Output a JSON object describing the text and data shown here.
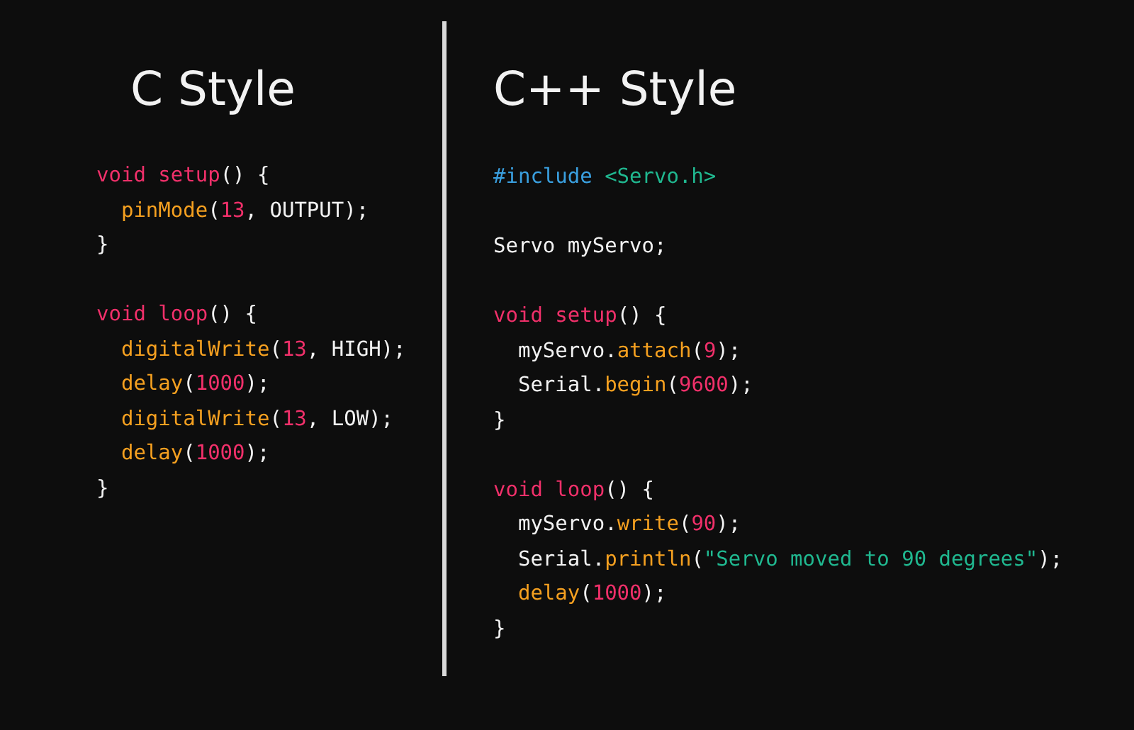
{
  "panels": [
    {
      "title": "C Style",
      "blocks": [
        {
          "lines": [
            {
              "tokens": [
                {
                  "kind": "keyword",
                  "text": "void "
                },
                {
                  "kind": "keyword",
                  "text": "setup"
                },
                {
                  "kind": "plain",
                  "text": "() {"
                }
              ]
            },
            {
              "tokens": [
                {
                  "kind": "function",
                  "text": "  pinMode"
                },
                {
                  "kind": "plain",
                  "text": "("
                },
                {
                  "kind": "number",
                  "text": "13"
                },
                {
                  "kind": "plain",
                  "text": ", OUTPUT);"
                }
              ]
            },
            {
              "tokens": [
                {
                  "kind": "plain",
                  "text": "}"
                }
              ]
            }
          ]
        },
        {
          "lines": [
            {
              "tokens": [
                {
                  "kind": "keyword",
                  "text": "void "
                },
                {
                  "kind": "keyword",
                  "text": "loop"
                },
                {
                  "kind": "plain",
                  "text": "() {"
                }
              ]
            },
            {
              "tokens": [
                {
                  "kind": "function",
                  "text": "  digitalWrite"
                },
                {
                  "kind": "plain",
                  "text": "("
                },
                {
                  "kind": "number",
                  "text": "13"
                },
                {
                  "kind": "plain",
                  "text": ", HIGH);"
                }
              ]
            },
            {
              "tokens": [
                {
                  "kind": "function",
                  "text": "  delay"
                },
                {
                  "kind": "plain",
                  "text": "("
                },
                {
                  "kind": "number",
                  "text": "1000"
                },
                {
                  "kind": "plain",
                  "text": ");"
                }
              ]
            },
            {
              "tokens": [
                {
                  "kind": "function",
                  "text": "  digitalWrite"
                },
                {
                  "kind": "plain",
                  "text": "("
                },
                {
                  "kind": "number",
                  "text": "13"
                },
                {
                  "kind": "plain",
                  "text": ", LOW);"
                }
              ]
            },
            {
              "tokens": [
                {
                  "kind": "function",
                  "text": "  delay"
                },
                {
                  "kind": "plain",
                  "text": "("
                },
                {
                  "kind": "number",
                  "text": "1000"
                },
                {
                  "kind": "plain",
                  "text": ");"
                }
              ]
            },
            {
              "tokens": [
                {
                  "kind": "plain",
                  "text": "}"
                }
              ]
            }
          ]
        }
      ]
    },
    {
      "title": "C++ Style",
      "blocks": [
        {
          "lines": [
            {
              "tokens": [
                {
                  "kind": "preprocessor",
                  "text": "#include "
                },
                {
                  "kind": "string",
                  "text": "<Servo.h>"
                }
              ]
            }
          ]
        },
        {
          "lines": [
            {
              "tokens": [
                {
                  "kind": "plain",
                  "text": "Servo myServo;"
                }
              ]
            }
          ]
        },
        {
          "lines": [
            {
              "tokens": [
                {
                  "kind": "keyword",
                  "text": "void "
                },
                {
                  "kind": "keyword",
                  "text": "setup"
                },
                {
                  "kind": "plain",
                  "text": "() {"
                }
              ]
            },
            {
              "tokens": [
                {
                  "kind": "plain",
                  "text": "  myServo."
                },
                {
                  "kind": "function",
                  "text": "attach"
                },
                {
                  "kind": "plain",
                  "text": "("
                },
                {
                  "kind": "number",
                  "text": "9"
                },
                {
                  "kind": "plain",
                  "text": ");"
                }
              ]
            },
            {
              "tokens": [
                {
                  "kind": "plain",
                  "text": "  Serial."
                },
                {
                  "kind": "function",
                  "text": "begin"
                },
                {
                  "kind": "plain",
                  "text": "("
                },
                {
                  "kind": "number",
                  "text": "9600"
                },
                {
                  "kind": "plain",
                  "text": ");"
                }
              ]
            },
            {
              "tokens": [
                {
                  "kind": "plain",
                  "text": "}"
                }
              ]
            }
          ]
        },
        {
          "lines": [
            {
              "tokens": [
                {
                  "kind": "keyword",
                  "text": "void "
                },
                {
                  "kind": "keyword",
                  "text": "loop"
                },
                {
                  "kind": "plain",
                  "text": "() {"
                }
              ]
            },
            {
              "tokens": [
                {
                  "kind": "plain",
                  "text": "  myServo."
                },
                {
                  "kind": "function",
                  "text": "write"
                },
                {
                  "kind": "plain",
                  "text": "("
                },
                {
                  "kind": "number",
                  "text": "90"
                },
                {
                  "kind": "plain",
                  "text": ");"
                }
              ]
            },
            {
              "tokens": [
                {
                  "kind": "plain",
                  "text": "  Serial."
                },
                {
                  "kind": "function",
                  "text": "println"
                },
                {
                  "kind": "plain",
                  "text": "("
                },
                {
                  "kind": "string",
                  "text": "\"Servo moved to 90 degrees\""
                },
                {
                  "kind": "plain",
                  "text": ");"
                }
              ]
            },
            {
              "tokens": [
                {
                  "kind": "function",
                  "text": "  delay"
                },
                {
                  "kind": "plain",
                  "text": "("
                },
                {
                  "kind": "number",
                  "text": "1000"
                },
                {
                  "kind": "plain",
                  "text": ");"
                }
              ]
            },
            {
              "tokens": [
                {
                  "kind": "plain",
                  "text": "}"
                }
              ]
            }
          ]
        }
      ]
    }
  ]
}
